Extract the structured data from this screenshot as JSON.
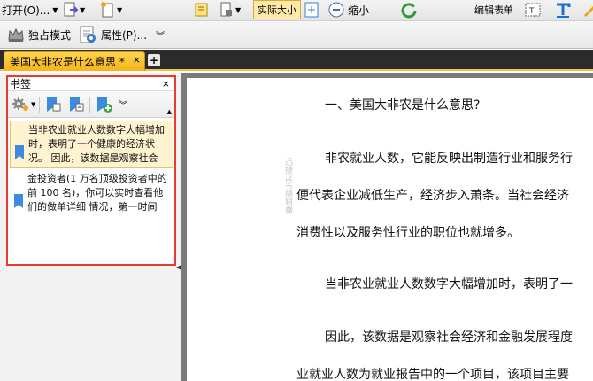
{
  "toolbar1": {
    "open_menu": "打开(O)...",
    "actual_size": "实际大小",
    "zoom_out": "缩小",
    "edit_form": "编辑表单"
  },
  "toolbar2": {
    "exclusive_mode": "独占模式",
    "properties": "属性(P)..."
  },
  "tabs": [
    {
      "label": "美国大非农是什么意思 *",
      "close": "×"
    }
  ],
  "tab_add": "+",
  "bookmarks": {
    "title": "书签",
    "close": "×",
    "items": [
      {
        "text": "当非农业就业人数数字大幅增加时，表明了一个健康的经济状况。 因此，该数据是观察社会"
      },
      {
        "text": "金投资者(1 万名顶级投资者中的前 100 名)，你可以实时查看他们的做单详细 情况，第一时间"
      }
    ]
  },
  "document": {
    "lines": [
      "一、美国大非农是什么意思?",
      "非农就业人数，它能反映出制造行业和服务行",
      "便代表企业减低生产，经济步入萧条。当社会经济",
      "消费性以及服务性行业的职位也就增多。",
      "当非农业就业人数数字大幅增加时，表明了一",
      "因此，该数据是观察社会经济和金融发展程度",
      "业就业人数为就业报告中的一个项目，该项目主要"
    ],
    "watermark": "迅捷PDF编辑器"
  },
  "colors": {
    "tab_active": "#f6b41a",
    "highlight_border": "#e53c2e",
    "selected_item": "#fff3d0"
  }
}
